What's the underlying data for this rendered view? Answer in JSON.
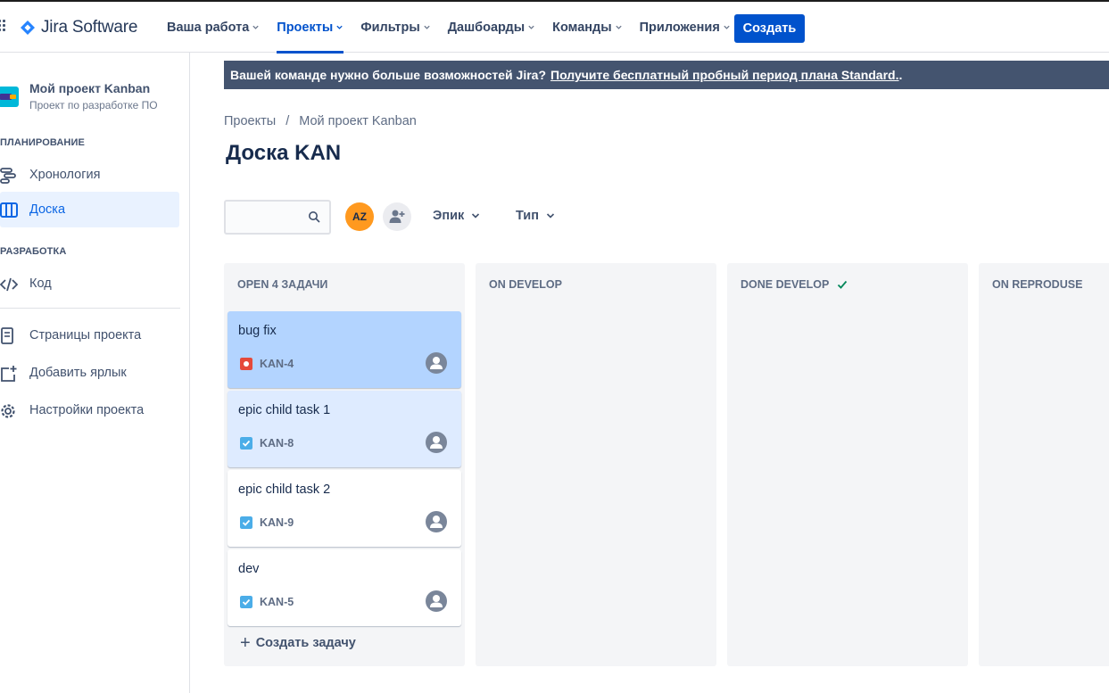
{
  "app": {
    "name": "Jira Software",
    "brand_color": "#0052cc"
  },
  "nav": {
    "items": [
      {
        "label": "Ваша работа",
        "active": false
      },
      {
        "label": "Проекты",
        "active": true
      },
      {
        "label": "Фильтры",
        "active": false
      },
      {
        "label": "Дашбоарды",
        "active": false
      },
      {
        "label": "Команды",
        "active": false
      },
      {
        "label": "Приложения",
        "active": false
      }
    ],
    "create_label": "Создать"
  },
  "sidebar": {
    "project_name": "Мой проект Kanban",
    "project_subtitle": "Проект по разработке ПО",
    "sections": [
      {
        "heading": "ПЛАНИРОВАНИЕ"
      },
      {
        "heading": "РАЗРАБОТКА"
      }
    ],
    "items": [
      {
        "label": "Хронология",
        "icon": "timeline-icon"
      },
      {
        "label": "Доска",
        "icon": "board-icon",
        "active": true
      },
      {
        "label": "Код",
        "icon": "code-icon"
      },
      {
        "label": "Страницы проекта",
        "icon": "pages-icon"
      },
      {
        "label": "Добавить ярлык",
        "icon": "add-shortcut-icon"
      },
      {
        "label": "Настройки проекта",
        "icon": "gear-icon"
      }
    ]
  },
  "banner": {
    "text": "Вашей команде нужно больше возможностей Jira?",
    "link": "Получите бесплатный пробный период плана Standard.",
    "suffix": "."
  },
  "breadcrumb": {
    "items": [
      "Проекты",
      "Мой проект Kanban"
    ],
    "separator": "/"
  },
  "page_title": "Доска KAN",
  "toolbar": {
    "search_placeholder": "",
    "avatar_initials": "AZ",
    "filters": [
      "Эпик",
      "Тип"
    ]
  },
  "board": {
    "columns": [
      {
        "title": "OPEN 4 ЗАДАЧИ"
      },
      {
        "title": "ON DEVELOP"
      },
      {
        "title": "DONE DEVELOP",
        "done": true
      },
      {
        "title": "ON REPRODUSE"
      }
    ],
    "cards": [
      {
        "title": "bug fix",
        "key": "KAN-4",
        "type": "bug",
        "state": "selected"
      },
      {
        "title": "epic child task 1",
        "key": "KAN-8",
        "type": "task",
        "state": "hover"
      },
      {
        "title": "epic child task 2",
        "key": "KAN-9",
        "type": "task",
        "state": "normal"
      },
      {
        "title": "dev",
        "key": "KAN-5",
        "type": "task",
        "state": "normal"
      }
    ],
    "create_task_label": "Создать задачу"
  },
  "colors": {
    "bug": "#e5493a",
    "task": "#4bade8",
    "done_check": "#00875a",
    "banner_bg": "#44546f"
  }
}
